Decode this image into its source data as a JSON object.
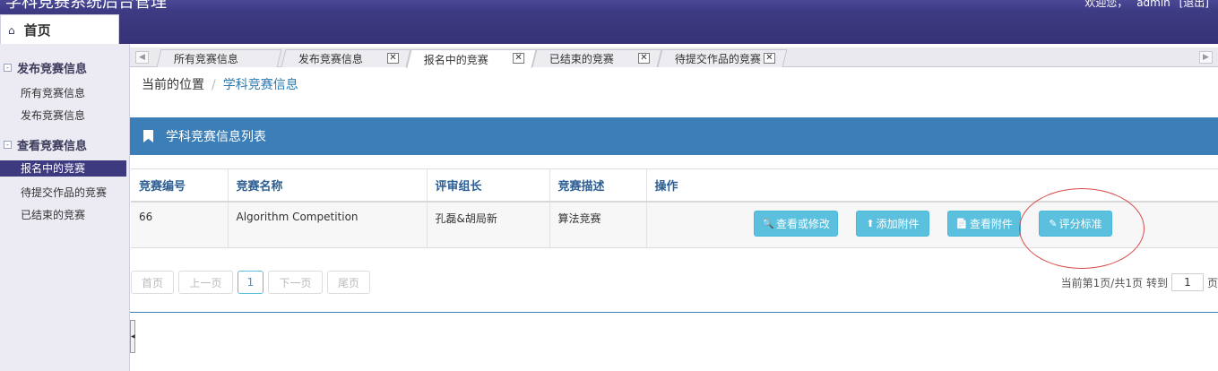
{
  "app": {
    "title": "学科竞赛系统后台管理",
    "welcome": "欢迎您，",
    "user": "admin",
    "logout": "[退出]"
  },
  "home_tab": "首页",
  "sidebar": {
    "groups": [
      {
        "label": "发布竞赛信息",
        "items": [
          "所有竞赛信息",
          "发布竞赛信息"
        ]
      },
      {
        "label": "查看竞赛信息",
        "items": [
          "报名中的竞赛",
          "待提交作品的竞赛",
          "已结束的竞赛"
        ]
      }
    ],
    "active_item": "报名中的竞赛"
  },
  "tabs": [
    {
      "label": "所有竞赛信息",
      "closable": false
    },
    {
      "label": "发布竞赛信息",
      "closable": true
    },
    {
      "label": "报名中的竞赛",
      "closable": true,
      "active": true
    },
    {
      "label": "已结束的竞赛",
      "closable": true
    },
    {
      "label": "待提交作品的竞赛",
      "closable": true
    }
  ],
  "breadcrumb": {
    "prefix": "当前的位置",
    "separator": "/",
    "current": "学科竞赛信息"
  },
  "panel": {
    "title": "学科竞赛信息列表"
  },
  "table": {
    "columns": [
      "竞赛编号",
      "竞赛名称",
      "评审组长",
      "竞赛描述",
      "操作"
    ],
    "rows": [
      {
        "id": "66",
        "name": "Algorithm Competition",
        "leader": "孔磊&胡局新",
        "desc": "算法竞赛"
      }
    ],
    "actions": [
      "查看或修改",
      "添加附件",
      "查看附件",
      "评分标准"
    ]
  },
  "pager": {
    "first": "首页",
    "prev": "上一页",
    "current": "1",
    "next": "下一页",
    "last": "尾页",
    "info": "当前第1页/共1页",
    "goto_label": "转到",
    "goto_value": "1",
    "page_unit": "页"
  },
  "colors": {
    "header": "#3e3b85",
    "panel_head": "#3c7fb8",
    "btn_info": "#5bc0de",
    "highlight_circle": "#d84a4a"
  }
}
